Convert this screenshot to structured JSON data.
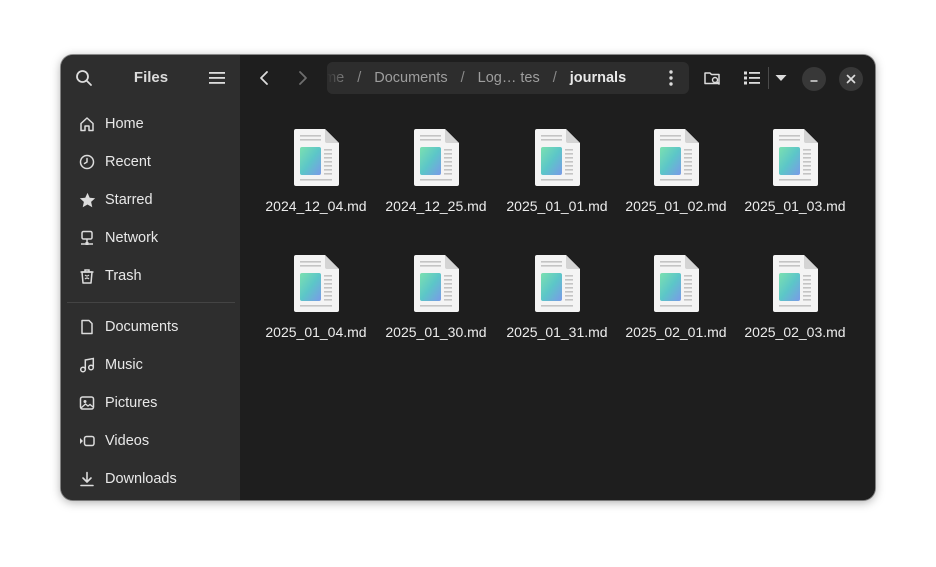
{
  "sidebar": {
    "title": "Files",
    "places": [
      {
        "label": "Home",
        "icon": "home-icon"
      },
      {
        "label": "Recent",
        "icon": "clock-icon"
      },
      {
        "label": "Starred",
        "icon": "star-icon"
      },
      {
        "label": "Network",
        "icon": "network-icon"
      },
      {
        "label": "Trash",
        "icon": "trash-icon"
      }
    ],
    "bookmarks": [
      {
        "label": "Documents",
        "icon": "document-icon"
      },
      {
        "label": "Music",
        "icon": "music-icon"
      },
      {
        "label": "Pictures",
        "icon": "picture-icon"
      },
      {
        "label": "Videos",
        "icon": "video-icon"
      },
      {
        "label": "Downloads",
        "icon": "download-icon"
      }
    ]
  },
  "pathbar": {
    "crumbs": [
      "ome",
      "Documents",
      "Log… tes",
      "journals"
    ],
    "separator": "/"
  },
  "files": [
    {
      "name": "2024_12_04.md"
    },
    {
      "name": "2024_12_25.md"
    },
    {
      "name": "2025_01_01.md"
    },
    {
      "name": "2025_01_02.md"
    },
    {
      "name": "2025_01_03.md"
    },
    {
      "name": "2025_01_04.md"
    },
    {
      "name": "2025_01_30.md"
    },
    {
      "name": "2025_01_31.md"
    },
    {
      "name": "2025_02_01.md"
    },
    {
      "name": "2025_02_03.md"
    }
  ],
  "colors": {
    "window_bg": "#1e1e1e",
    "sidebar_bg": "#2e2e2e",
    "text": "#e8e8e8",
    "muted": "#9e9e9e"
  }
}
